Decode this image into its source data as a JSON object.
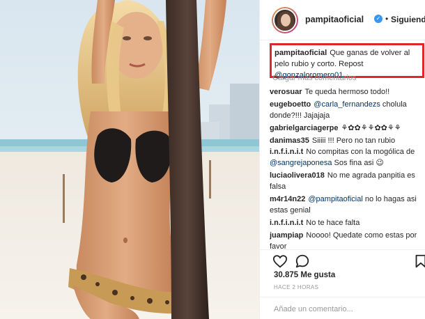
{
  "post": {
    "author": "pampitaoficial",
    "verified_icon": "verified-badge-icon",
    "separator": "•",
    "follow_status": "Siguiendo",
    "highlight_color": "#e0262b",
    "caption": {
      "user": "pampitaoficial",
      "text": "Que ganas de volver al pelo rubio y corto. Repost",
      "mention": "@gonzaloromero01"
    },
    "load_more": "Cargar más comentarios",
    "comments": [
      {
        "user": "verosuar",
        "pre": "Te queda hermoso todo!!",
        "mention": "",
        "post": ""
      },
      {
        "user": "eugeboetto",
        "pre": "",
        "mention": "@carla_fernandezs",
        "post": "cholula donde?!!! Jajajaja"
      },
      {
        "user": "gabrielgarciagerpe",
        "pre": "⚘✿✿⚘⚘✿✿⚘⚘",
        "mention": "",
        "post": ""
      },
      {
        "user": "danimas35",
        "pre": "Siiiii !!! Pero no tan rubio",
        "mention": "",
        "post": ""
      },
      {
        "user": "i.n.f.i.n.i.t",
        "pre": "No compitas con la mogólica de",
        "mention": "@sangrejaponesa",
        "post": "Sos fina asi 😉"
      },
      {
        "user": "luciaolivera018",
        "pre": "No me agrada panpitia es falsa",
        "mention": "",
        "post": ""
      },
      {
        "user": "m4r14n22",
        "pre": "",
        "mention": "@pampitaoficial",
        "post": "no lo hagas asi estas genial"
      },
      {
        "user": "i.n.f.i.n.i.t",
        "pre": "No te hace falta",
        "mention": "",
        "post": ""
      },
      {
        "user": "juampiap",
        "pre": "Noooo! Quedate como estas por favor",
        "mention": "",
        "post": ""
      }
    ],
    "actions": {
      "like_icon": "heart-icon",
      "comment_icon": "comment-icon",
      "save_icon": "bookmark-icon"
    },
    "likes": "30.875 Me gusta",
    "time": "HACE 2 HORAS",
    "add_comment_placeholder": "Añade un comentario..."
  }
}
